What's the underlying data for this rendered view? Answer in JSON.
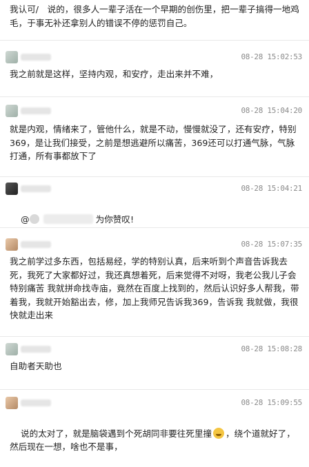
{
  "comments": [
    {
      "time": "",
      "text": "我认可/　说的，很多人一辈子活在一个早期的创伤里，把一辈子搞得一地鸡毛，于事无补还拿别人的错误不停的惩罚自己。"
    },
    {
      "time": "08-28 15:02:53",
      "text": "我之前就是这样，坚持内观，和安疗，走出来并不难，"
    },
    {
      "time": "08-28 15:04:20",
      "text": "就是内观，情绪来了，管他什么，就是不动，慢慢就没了，还有安疗，特别369，是让我们接受，之前是想逃避所以痛苦，369还可以打通气脉，气脉打通，所有事都放下了"
    },
    {
      "time": "08-28 15:04:21",
      "text_prefix": "@",
      "text": "为你赞叹!"
    },
    {
      "time": "08-28 15:07:35",
      "text": "我之前学过多东西，包括易经，学的特别认真，后来听到个声音告诉我去死，我死了大家都好过，我还真想着死，后来觉得不对呀，我老公我儿子会特别痛苦 我就拼命找寺庙，竟然在百度上找到的，然后认识好多人帮我，带着我，我就开始豁出去，修，加上我师兄告诉我369，告诉我 我就做，我很快就走出来"
    },
    {
      "time": "08-28 15:08:28",
      "text": "自助者天助也"
    },
    {
      "time": "08-28 15:09:55",
      "text": "说的太对了，就是脑袋遇到个死胡同非要往死里撞",
      "text_after_emoji": "，绕个道就好了，然后现在一想，啥也不是事，"
    }
  ],
  "icons": [
    "avatar",
    "emoji-sweat-smile"
  ]
}
